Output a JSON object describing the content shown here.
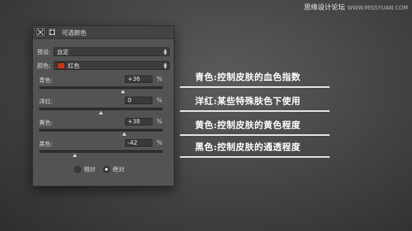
{
  "watermark": {
    "text": "思缘设计论坛",
    "site": "WWW.MISSYUAN.COM"
  },
  "panel": {
    "title": "可选颜色",
    "preset": {
      "label": "预设:",
      "value": "自定"
    },
    "colors": {
      "label": "颜色:",
      "value": "红色",
      "swatch": "#c8351c"
    },
    "sliders": [
      {
        "label": "青色:",
        "value": "+36",
        "unit": "%",
        "level": 0.68
      },
      {
        "label": "洋红:",
        "value": "0",
        "unit": "%",
        "level": 0.5
      },
      {
        "label": "黄色:",
        "value": "+38",
        "unit": "%",
        "level": 0.69
      },
      {
        "label": "黑色:",
        "value": "-42",
        "unit": "%",
        "level": 0.29
      }
    ],
    "method": {
      "relative": "相对",
      "absolute": "绝对",
      "selected": "absolute"
    }
  },
  "annotations": [
    "青色:控制皮肤的血色指数",
    "洋红:某些特殊肤色下使用",
    "黄色:控制皮肤的黄色程度",
    "黑色:控制皮肤的通透程度"
  ]
}
